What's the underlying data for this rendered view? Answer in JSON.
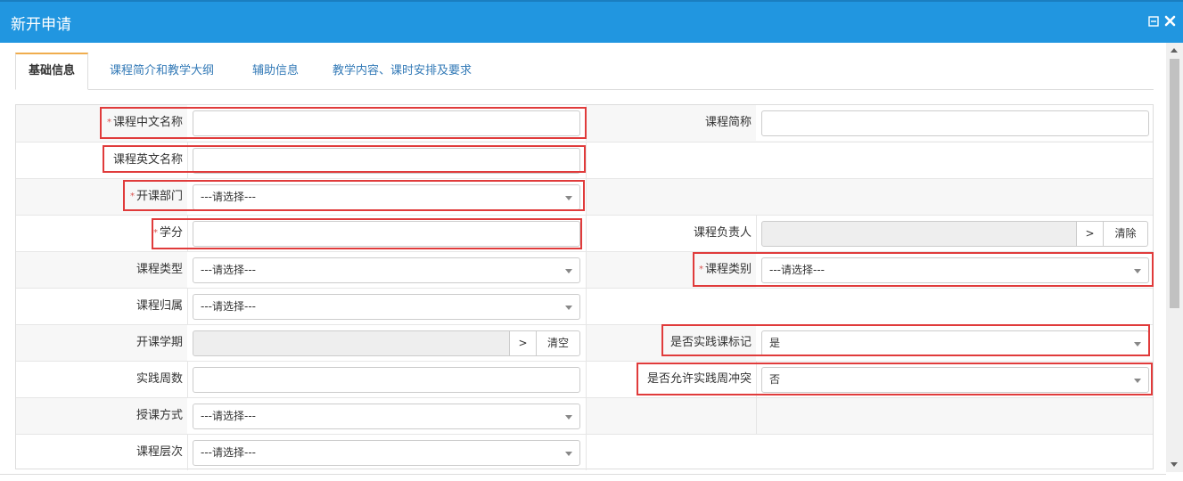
{
  "window": {
    "title": "新开申请",
    "icons": [
      "minimize-icon",
      "close-icon"
    ]
  },
  "tabs": [
    {
      "label": "基础信息",
      "active": true
    },
    {
      "label": "课程简介和教学大纲",
      "active": false
    },
    {
      "label": "辅助信息",
      "active": false
    },
    {
      "label": "教学内容、课时安排及要求",
      "active": false
    }
  ],
  "form": {
    "course_cn_name": {
      "label": "课程中文名称",
      "value": "",
      "required": true
    },
    "course_short_name": {
      "label": "课程简称",
      "value": ""
    },
    "course_en_name": {
      "label": "课程英文名称",
      "value": ""
    },
    "department": {
      "label": "开课部门",
      "value": "---请选择---",
      "required": true
    },
    "credit": {
      "label": "学分",
      "value": "",
      "required": true
    },
    "course_owner": {
      "label": "课程负责人",
      "value": "",
      "select_button": ">",
      "clear_button": "清除"
    },
    "course_type": {
      "label": "课程类型",
      "value": "---请选择---"
    },
    "course_category": {
      "label": "课程类别",
      "value": "---请选择---",
      "required": true
    },
    "course_affiliation": {
      "label": "课程归属",
      "value": "---请选择---"
    },
    "semester": {
      "label": "开课学期",
      "value": "",
      "select_button": ">",
      "clear_button": "清空"
    },
    "practice_flag": {
      "label": "是否实践课标记",
      "value": "是"
    },
    "practice_weeks": {
      "label": "实践周数",
      "value": ""
    },
    "allow_week_conflict": {
      "label": "是否允许实践周冲突",
      "value": "否"
    },
    "teaching_mode": {
      "label": "授课方式",
      "value": "---请选择---"
    },
    "course_level": {
      "label": "课程层次",
      "value": "---请选择---"
    }
  },
  "colors": {
    "titlebar": "#2196e0",
    "highlight": "#e03b3b",
    "required_star": "#d9534f",
    "tab_link": "#337ab7",
    "active_tab_top": "#f0ad4e"
  }
}
